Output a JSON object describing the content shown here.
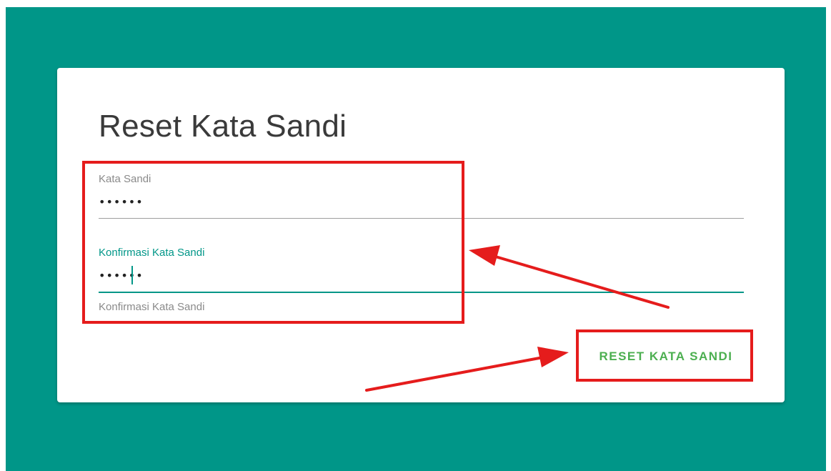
{
  "form": {
    "title": "Reset Kata Sandi",
    "password": {
      "label": "Kata Sandi",
      "value": "••••••"
    },
    "confirm": {
      "label": "Konfirmasi Kata Sandi",
      "value": "••••••",
      "helper": "Konfirmasi Kata Sandi"
    },
    "submit_label": "RESET KATA SANDI"
  },
  "colors": {
    "background": "#009688",
    "accent": "#009688",
    "button_text": "#4caf50",
    "annotation": "#e51c1c"
  }
}
